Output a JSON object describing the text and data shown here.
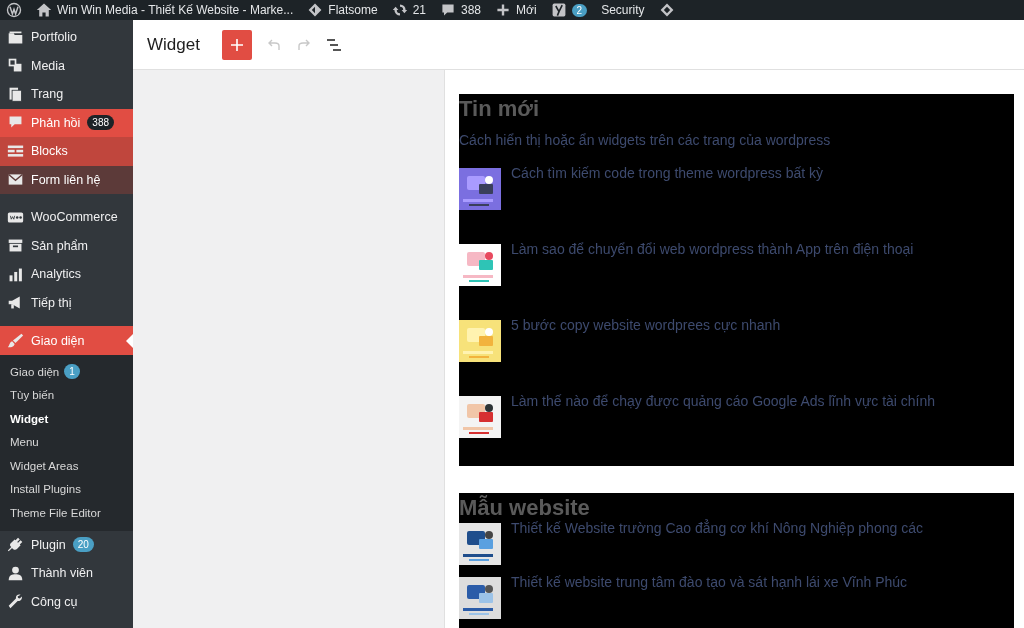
{
  "admin_bar": {
    "items": [
      {
        "kind": "wp-logo"
      },
      {
        "kind": "home",
        "label": "Win Win Media - Thiết Kế Website - Marke..."
      },
      {
        "kind": "flatsome",
        "label": "Flatsome"
      },
      {
        "kind": "updates",
        "label": "21"
      },
      {
        "kind": "comments",
        "label": "388"
      },
      {
        "kind": "new",
        "label": "Mới"
      },
      {
        "kind": "yoast",
        "badge": "2"
      },
      {
        "kind": "text",
        "label": "Security"
      },
      {
        "kind": "diamond"
      }
    ]
  },
  "sidebar": {
    "groups": [
      [
        {
          "label": "Portfolio",
          "selected": false
        },
        {
          "label": "Media",
          "selected": false
        },
        {
          "label": "Trang",
          "selected": false
        },
        {
          "label": "Phản hồi",
          "badge": "388",
          "selected": false,
          "color": "#e14d43"
        },
        {
          "label": "Blocks",
          "selected": false,
          "color": "#c0463d"
        },
        {
          "label": "Form liên hệ",
          "selected": false,
          "color": "#5c3a39"
        }
      ],
      [
        {
          "label": "WooCommerce",
          "selected": false
        },
        {
          "label": "Sản phẩm",
          "selected": false
        },
        {
          "label": "Analytics",
          "selected": false
        },
        {
          "label": "Tiếp thị",
          "selected": false
        }
      ],
      [
        {
          "label": "Giao diện",
          "selected": true,
          "children": [
            {
              "label": "Giao diện",
              "badge": "1",
              "selected": false
            },
            {
              "label": "Tùy biến",
              "selected": false
            },
            {
              "label": "Widget",
              "selected": true
            },
            {
              "label": "Menu",
              "selected": false
            },
            {
              "label": "Widget Areas",
              "selected": false
            },
            {
              "label": "Install Plugins",
              "selected": false
            },
            {
              "label": "Theme File Editor",
              "selected": false
            }
          ]
        },
        {
          "label": "Plugin",
          "badge": "20",
          "selected": false
        },
        {
          "label": "Thành viên",
          "selected": false
        },
        {
          "label": "Công cụ",
          "selected": false
        }
      ]
    ]
  },
  "editor": {
    "title": "Widget",
    "toolbar": [
      {
        "kind": "add",
        "disabled": false
      },
      {
        "kind": "undo",
        "disabled": true
      },
      {
        "kind": "redo",
        "disabled": true
      },
      {
        "kind": "list-view",
        "disabled": false
      }
    ]
  },
  "widget_areas": [
    {
      "title": "Tin mới",
      "intro": "Cách hiển thị hoặc ẩn widgets trên các trang của wordpress",
      "posts": [
        {
          "title": "Cách tìm kiếm code trong theme wordpress bất kỳ"
        },
        {
          "title": "Làm sao để chuyển đổi web wordpress thành App trên điện thoại"
        },
        {
          "title": "5 bước copy website wordprees cực nhanh"
        },
        {
          "title": "Làm thế nào để chạy được quảng cáo Google Ads lĩnh vực tài chính"
        }
      ]
    },
    {
      "title": "Mẫu website",
      "posts": [
        {
          "title": "Thiết kế Website trường Cao đẳng cơ khí Nông Nghiệp phong các"
        },
        {
          "title": "Thiết kế website trung tâm đào tạo và sát hạnh lái xe Vĩnh Phúc"
        }
      ]
    }
  ]
}
